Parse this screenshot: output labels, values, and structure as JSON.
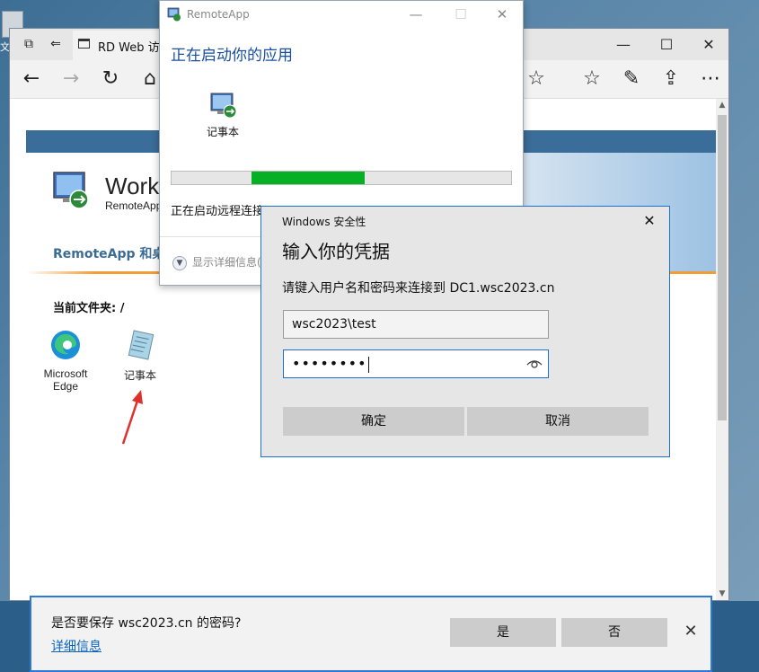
{
  "desktop": {
    "icon_label": "文"
  },
  "browser": {
    "tab_title": "RD Web 访问",
    "window_controls": [
      "—",
      "☐",
      "✕"
    ]
  },
  "rdweb": {
    "title": "Work",
    "subtitle": "RemoteApp",
    "nav_label": "RemoteApp 和桌面",
    "current_folder": "当前文件夹: /",
    "apps": [
      {
        "label": "Microsoft Edge",
        "icon": "edge-icon"
      },
      {
        "label": "记事本",
        "icon": "notepad-icon"
      }
    ]
  },
  "save_bar": {
    "question": "是否要保存 wsc2023.cn 的密码?",
    "details_link": "详细信息",
    "yes": "是",
    "no": "否",
    "close": "✕"
  },
  "remoteapp": {
    "title": "RemoteApp",
    "heading": "正在启动你的应用",
    "app_label": "记事本",
    "status": "正在启动远程连接...",
    "details": "显示详细信息(D)",
    "progress": {
      "start": 0.235,
      "end": 0.57
    },
    "colors": {
      "progress": "#06b025",
      "heading": "#1a4fa0"
    }
  },
  "security": {
    "title": "Windows 安全性",
    "heading": "输入你的凭据",
    "description": "请键入用户名和密码来连接到 DC1.wsc2023.cn",
    "username": "wsc2023\\test",
    "password_mask": "••••••••",
    "ok": "确定",
    "cancel": "取消",
    "close": "✕"
  }
}
